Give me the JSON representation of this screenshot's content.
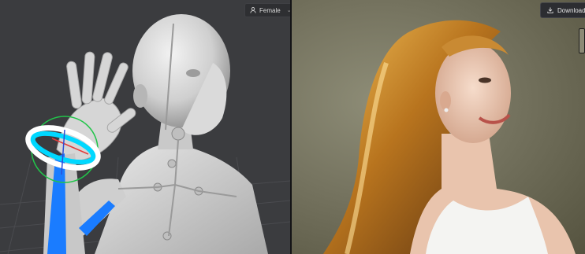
{
  "viewport": {
    "model_selector": {
      "label": "Female",
      "icon": "person-icon",
      "chevron": "chevron-down-icon"
    }
  },
  "result": {
    "download": {
      "label": "Download",
      "icon": "download-icon"
    }
  },
  "colors": {
    "viewport_bg": "#3b3c3f",
    "gizmo_ring": "#00d8ff",
    "bone_highlight": "#1a7cff",
    "rotation_circle": "#21c54a"
  }
}
